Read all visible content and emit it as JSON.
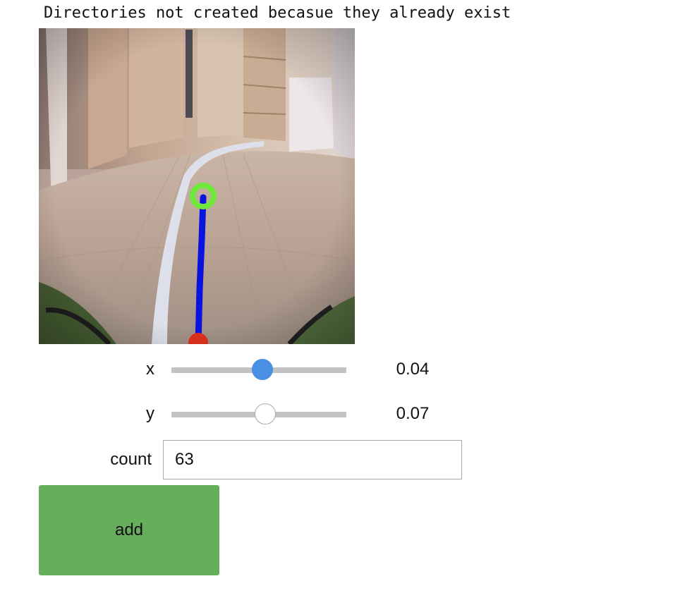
{
  "output": {
    "message": "Directories not created becasue they already exist"
  },
  "camera": {
    "description_icon": "camera-feed-image",
    "overlay_colors": {
      "target_ring": "#6ee83a",
      "direction_line": "#0a12e0",
      "origin_marker": "#e0301e"
    }
  },
  "sliders": {
    "x": {
      "label": "x",
      "value": "0.04",
      "handle_position_fraction": 0.52,
      "active": true
    },
    "y": {
      "label": "y",
      "value": "0.07",
      "handle_position_fraction": 0.535,
      "active": false
    }
  },
  "count": {
    "label": "count",
    "value": "63"
  },
  "add_button": {
    "label": "add",
    "color": "#66ad5c"
  },
  "colors": {
    "slider_active": "#4a90e2",
    "slider_track": "#c3c3c3"
  }
}
